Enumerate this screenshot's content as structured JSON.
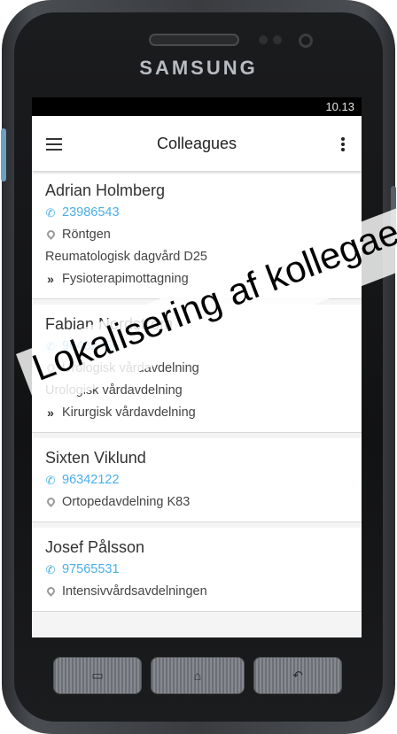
{
  "device": {
    "brand": "SAMSUNG"
  },
  "statusbar": {
    "time": "10.13"
  },
  "toolbar": {
    "title": "Colleagues"
  },
  "colleagues": [
    {
      "name": "Adrian Holmberg",
      "phone": "23986543",
      "location": "Röntgen",
      "department": "Reumatologisk dagvård D25",
      "next": "Fysioterapimottagning"
    },
    {
      "name": "Fabian Nordström",
      "phone": "96432456",
      "location": "Urologisk vårdavdelning",
      "department": "Urologisk vårdavdelning",
      "next": "Kirurgisk vårdavdelning"
    },
    {
      "name": "Sixten Viklund",
      "phone": "96342122",
      "location": "Ortopedavdelning K83"
    },
    {
      "name": "Josef Pålsson",
      "phone": "97565531",
      "location": "Intensivvårdsavdelningen"
    }
  ],
  "overlay": {
    "text": "Lokalisering af kollegaer"
  }
}
